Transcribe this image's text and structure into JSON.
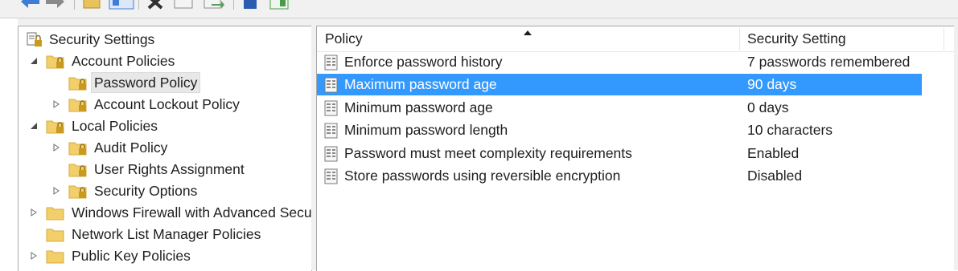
{
  "toolbar": {
    "buttons": [
      {
        "name": "back-button",
        "icon": "arrow-left-icon",
        "color": "#3b7dd8"
      },
      {
        "name": "forward-button",
        "icon": "arrow-right-icon",
        "color": "#8a8a8a"
      },
      {
        "name": "up-folder-button",
        "icon": "folder-up-icon",
        "color": "#e9c35a"
      },
      {
        "name": "show-hide-tree-button",
        "icon": "console-tree-icon",
        "color": "#3b7dd8"
      },
      {
        "name": "delete-button",
        "icon": "x-icon",
        "color": "#303030"
      },
      {
        "name": "properties-button",
        "icon": "properties-icon",
        "color": "#8a8a8a"
      },
      {
        "name": "export-list-button",
        "icon": "export-icon",
        "color": "#5aa05a"
      },
      {
        "name": "help-button",
        "icon": "help-icon",
        "color": "#2a5db0"
      },
      {
        "name": "action-pane-button",
        "icon": "action-pane-icon",
        "color": "#4a9a4a"
      }
    ]
  },
  "tree": {
    "root_label": "Security Settings",
    "items": [
      {
        "label": "Account Policies",
        "level": 1,
        "expander": "expanded",
        "locked": true
      },
      {
        "label": "Password Policy",
        "level": 2,
        "expander": "none",
        "locked": true,
        "selected": true
      },
      {
        "label": "Account Lockout Policy",
        "level": 2,
        "expander": "collapsed",
        "locked": true
      },
      {
        "label": "Local Policies",
        "level": 1,
        "expander": "expanded",
        "locked": true
      },
      {
        "label": "Audit Policy",
        "level": 2,
        "expander": "collapsed",
        "locked": true
      },
      {
        "label": "User Rights Assignment",
        "level": 2,
        "expander": "none",
        "locked": true
      },
      {
        "label": "Security Options",
        "level": 2,
        "expander": "collapsed",
        "locked": true
      },
      {
        "label": "Windows Firewall with Advanced Secu",
        "level": 1,
        "expander": "collapsed",
        "locked": false
      },
      {
        "label": "Network List Manager Policies",
        "level": 1,
        "expander": "none",
        "locked": false
      },
      {
        "label": "Public Key Policies",
        "level": 1,
        "expander": "collapsed",
        "locked": false
      }
    ]
  },
  "list": {
    "columns": {
      "policy": "Policy",
      "setting": "Security Setting"
    },
    "sort_column": "policy",
    "rows": [
      {
        "policy": "Enforce password history",
        "setting": "7 passwords remembered",
        "selected": false
      },
      {
        "policy": "Maximum password age",
        "setting": "90 days",
        "selected": true
      },
      {
        "policy": "Minimum password age",
        "setting": "0 days",
        "selected": false
      },
      {
        "policy": "Minimum password length",
        "setting": "10 characters",
        "selected": false
      },
      {
        "policy": "Password must meet complexity requirements",
        "setting": "Enabled",
        "selected": false
      },
      {
        "policy": "Store passwords using reversible encryption",
        "setting": "Disabled",
        "selected": false
      }
    ]
  },
  "colors": {
    "selection": "#3399ff",
    "selection_text": "#ffffff",
    "folder": "#f2cf6a",
    "folder_dark": "#d9a93a",
    "lock": "#c99a1e"
  }
}
